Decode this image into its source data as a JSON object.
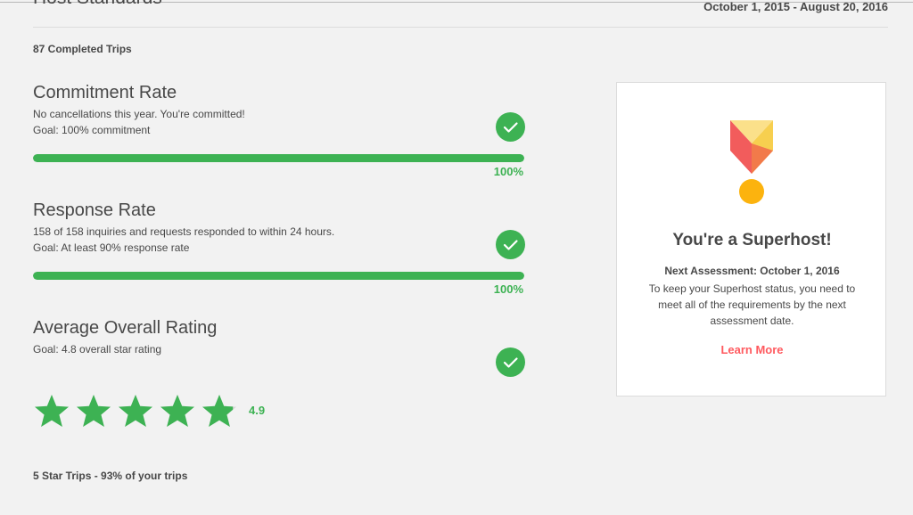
{
  "header": {
    "title": "Host Standards",
    "date_range": "October 1, 2015 - August 20, 2016",
    "completed_trips": "87 Completed Trips"
  },
  "metrics": [
    {
      "title": "Commitment Rate",
      "line1": "No cancellations this year. You're committed!",
      "line2": "Goal: 100% commitment",
      "percent_label": "100%",
      "progress": 1.0
    },
    {
      "title": "Response Rate",
      "line1": "158 of 158 inquiries and requests responded to within 24 hours.",
      "line2": "Goal: At least 90% response rate",
      "percent_label": "100%",
      "progress": 1.0
    },
    {
      "title": "Average Overall Rating",
      "line1": "Goal: 4.8 overall star rating",
      "rating_value": "4.9",
      "rating": 4.9,
      "max_rating": 5
    }
  ],
  "five_star_trips": "5 Star Trips - 93% of your trips",
  "card": {
    "title": "You're a Superhost!",
    "next_assessment": "Next Assessment: October 1, 2016",
    "description": "To keep your Superhost status, you need to meet all of the requirements by the next assessment date.",
    "link_label": "Learn More"
  },
  "colors": {
    "success": "#3db253",
    "accent_link": "#ff5a5f",
    "medal_red": "#f25c5c",
    "medal_orange": "#f2a63a",
    "medal_yellow": "#f7cf4f",
    "medal_pale": "#fbe08a",
    "medal_circle": "#fcb30e"
  },
  "icons": {
    "check": "check-circle-icon",
    "star": "star-icon",
    "medal": "superhost-medal-icon"
  }
}
